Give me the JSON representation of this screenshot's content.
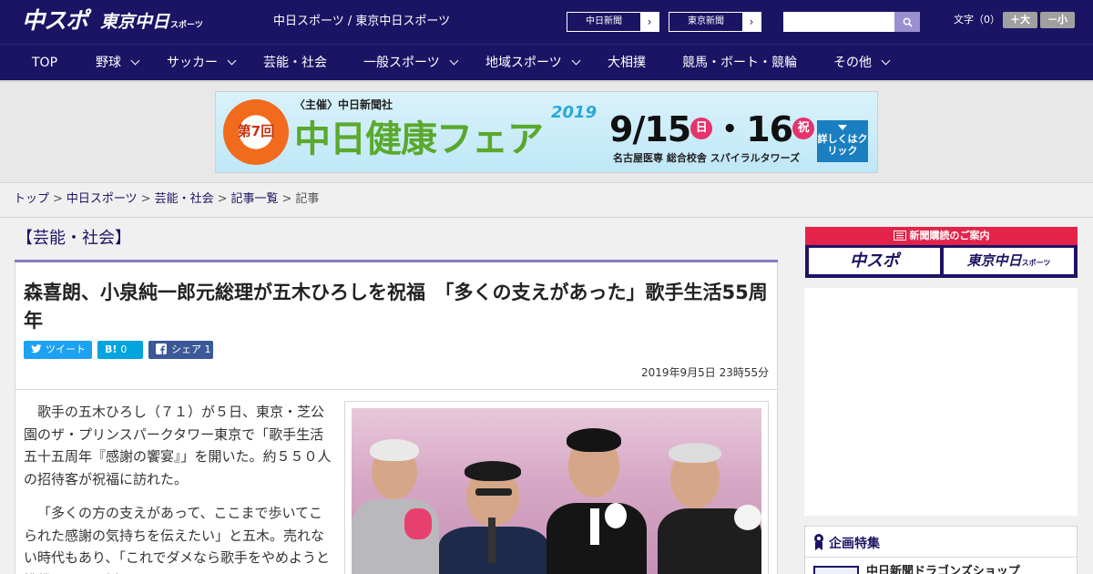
{
  "header": {
    "logo_main": "中スポ",
    "logo_tokyo": "東京中日",
    "logo_tokyo_sub": "スポーツ",
    "site_name": "中日スポーツ / 東京中日スポーツ",
    "btn_chunichi": "中日新聞",
    "btn_tokyo": "東京新聞",
    "search_placeholder": "",
    "font_label": "文字（0）",
    "font_large": "＋大",
    "font_small": "－小"
  },
  "nav": {
    "items": [
      {
        "label": "TOP"
      },
      {
        "label": "野球"
      },
      {
        "label": "サッカー"
      },
      {
        "label": "芸能・社会"
      },
      {
        "label": "一般スポーツ"
      },
      {
        "label": "地域スポーツ"
      },
      {
        "label": "大相撲"
      },
      {
        "label": "競馬・ボート・競輪"
      },
      {
        "label": "その他"
      }
    ]
  },
  "banner": {
    "badge": "第7回",
    "host": "〈主催〉中日新聞社",
    "event": "中日健康フェア",
    "year": "2019",
    "date_1": "9/15",
    "day_1": "日",
    "date_2": "・16",
    "day_2": "祝",
    "venue": "名古屋医専 総合校舎 スパイラルタワーズ",
    "click": "詳しくはクリック"
  },
  "breadcrumb": {
    "items": [
      "トップ",
      "中日スポーツ",
      "芸能・社会",
      "記事一覧"
    ],
    "current": "記事"
  },
  "article": {
    "category": "【芸能・社会】",
    "title": "森喜朗、小泉純一郎元総理が五木ひろしを祝福　「多くの支えがあった」歌手生活55周年",
    "share_tweet": "ツイート",
    "share_hatena": "0",
    "share_facebook": "シェア 1",
    "date": "2019年9月5日 23時55分",
    "paragraphs": [
      "歌手の五木ひろし（７１）が５日、東京・芝公園のザ・プリンスパークタワー東京で「歌手生活五十五周年『感謝の饗宴』」を開いた。約５５０人の招待客が祝福に訪れた。",
      "「多くの方の支えがあって、ここまで歩いてこられた感謝の気持ちを伝えたい」と五木。売れない時代もあり、「これでダメなら歌手をやめようと挑戦した」と話した。"
    ]
  },
  "sidebar": {
    "subscribe_head": "新聞購読のご案内",
    "sub_logo_1": "中スポ",
    "sub_logo_2": "東京中日",
    "sub_logo_2_sub": "スポーツ",
    "feature_title": "企画特集",
    "feature_item": "中日新聞ドラゴンズショップ"
  },
  "colors": {
    "brand_navy": "#1b1464",
    "accent_purple": "#8a7bbf",
    "twitter": "#1da1f2",
    "hatena": "#00a4de",
    "facebook": "#3b5998",
    "subscribe_red": "#e4234a"
  }
}
